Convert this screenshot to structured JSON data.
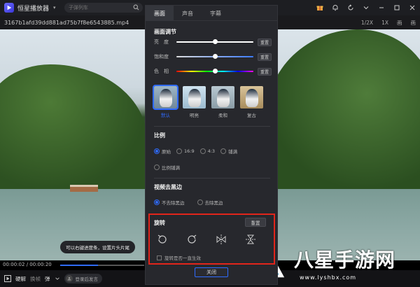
{
  "titlebar": {
    "app_name": "恒星播放器",
    "dropdown": "▾",
    "search_placeholder": "子弹列车"
  },
  "filebar": {
    "filename": "3167b1afd39dd881ad75b7f8e6543885.mp4",
    "speed_half": "1/2X",
    "speed_one": "1X",
    "mode_a": "画",
    "mode_b": "画"
  },
  "video": {
    "tooltip": "可以右键进度条，设置片头片尾",
    "current_time": "00:00:02",
    "time_sep": "/",
    "total_time": "00:00:20",
    "progress": 0.45
  },
  "controls": {
    "clear_label": "硬解",
    "vo_label": "换帧",
    "danmu_label": "弹",
    "login_label": "登录后发言"
  },
  "panel": {
    "tabs": [
      "画面",
      "声音",
      "字幕"
    ],
    "active_tab": 0,
    "adjust_title": "画面调节",
    "sliders": [
      {
        "label": "亮　度",
        "value": 0.5,
        "reset": "重置"
      },
      {
        "label": "饱和度",
        "value": 0.5,
        "reset": "重置"
      },
      {
        "label": "色　相",
        "value": 0.5,
        "reset": "重置"
      }
    ],
    "presets": [
      {
        "label": "默认",
        "selected": true
      },
      {
        "label": "明亮",
        "selected": false
      },
      {
        "label": "柔和",
        "selected": false
      },
      {
        "label": "复古",
        "selected": false
      }
    ],
    "ratio_title": "比例",
    "ratio_options": [
      "原始",
      "16:9",
      "4:3",
      "铺满"
    ],
    "ratio_options_2": [
      "比例铺满"
    ],
    "ratio_selected": 0,
    "blackbar_title": "视频去黑边",
    "blackbar_options": [
      "不去除黑边",
      "去除黑边"
    ],
    "blackbar_selected": 0,
    "rotate_title": "旋转",
    "rotate_reset": "重置",
    "rotate_icons": [
      "rotate-left-icon",
      "rotate-right-icon",
      "flip-horizontal-icon",
      "flip-vertical-icon"
    ],
    "rotate_checkbox": "旋转是否一直生效",
    "close_label": "关闭"
  },
  "watermark": {
    "text": "八星手游网",
    "url": "www.lyshbx.com"
  },
  "colors": {
    "accent": "#2f6bff",
    "highlight_box": "#e1251b",
    "panel_bg": "#27282d"
  }
}
